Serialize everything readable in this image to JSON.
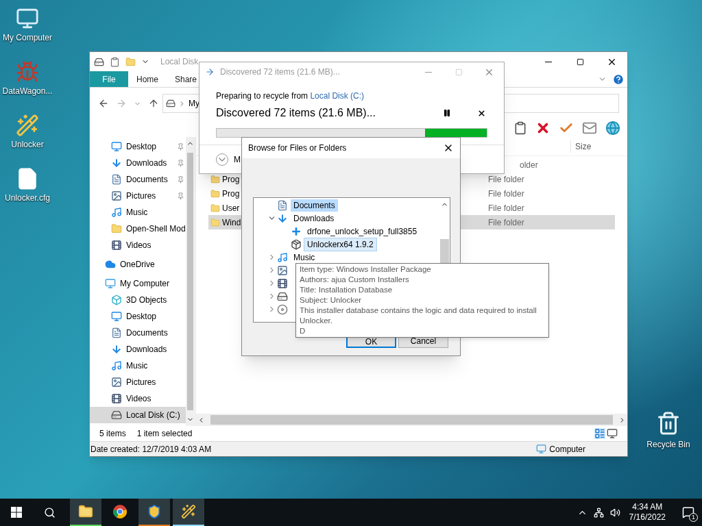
{
  "desktop_icons": [
    {
      "kind": "computer",
      "label": "My Computer"
    },
    {
      "kind": "app",
      "label": "DataWagon..."
    },
    {
      "kind": "unlocker",
      "label": "Unlocker"
    },
    {
      "kind": "file",
      "label": "Unlocker.cfg"
    }
  ],
  "recycle_bin": {
    "label": "Recycle Bin"
  },
  "explorer": {
    "title": "Local Disk",
    "ribbon_tabs": [
      {
        "label": "File",
        "selected": true
      },
      {
        "label": "Home",
        "selected": false
      },
      {
        "label": "Share",
        "selected": false
      }
    ],
    "breadcrumb": "My",
    "nav": [
      {
        "kind": "desktop",
        "label": "Desktop",
        "pinned": true,
        "selected": false
      },
      {
        "kind": "downloads",
        "label": "Downloads",
        "pinned": true,
        "selected": false
      },
      {
        "kind": "documents",
        "label": "Documents",
        "pinned": true,
        "selected": false
      },
      {
        "kind": "pictures",
        "label": "Pictures",
        "pinned": true,
        "selected": false
      },
      {
        "kind": "music",
        "label": "Music",
        "pinned": false,
        "selected": false
      },
      {
        "kind": "folder",
        "label": "Open-Shell Mod",
        "pinned": false,
        "selected": false
      },
      {
        "kind": "videos",
        "label": "Videos",
        "pinned": false,
        "selected": false
      },
      {
        "kind": "onedrive",
        "label": "OneDrive",
        "pinned": false,
        "selected": false,
        "top": true
      },
      {
        "kind": "computer",
        "label": "My Computer",
        "pinned": false,
        "selected": false,
        "top": true
      },
      {
        "kind": "objects3d",
        "label": "3D Objects",
        "pinned": false,
        "selected": false
      },
      {
        "kind": "desktop",
        "label": "Desktop",
        "pinned": false,
        "selected": false
      },
      {
        "kind": "documents",
        "label": "Documents",
        "pinned": false,
        "selected": false
      },
      {
        "kind": "downloads",
        "label": "Downloads",
        "pinned": false,
        "selected": false
      },
      {
        "kind": "music",
        "label": "Music",
        "pinned": false,
        "selected": false
      },
      {
        "kind": "pictures",
        "label": "Pictures",
        "pinned": false,
        "selected": false
      },
      {
        "kind": "videos",
        "label": "Videos",
        "pinned": false,
        "selected": false
      },
      {
        "kind": "disk",
        "label": "Local Disk (C:)",
        "pinned": false,
        "selected": true
      }
    ],
    "size_header": "Size",
    "rows": [
      {
        "type": "older",
        "selected": false
      },
      {
        "name": "Prog",
        "type": "File folder",
        "selected": false
      },
      {
        "name": "Prog",
        "type": "File folder",
        "selected": false
      },
      {
        "name": "User",
        "type": "File folder",
        "selected": false
      },
      {
        "name": "Wind",
        "type": "File folder",
        "selected": true
      }
    ],
    "item_count": "5 items",
    "selection": "1 item selected",
    "details": "Date created: 12/7/2019 4:03 AM",
    "location": "Computer"
  },
  "progress_dialog": {
    "title": "Discovered 72 items (21.6 MB)...",
    "source_prefix": "Preparing to recycle from ",
    "source_link": "Local Disk (C:)",
    "heading": "Discovered 72 items (21.6 MB)...",
    "bar": {
      "kind": "marquee"
    },
    "more": "M"
  },
  "browse_dialog": {
    "title": "Browse for Files or Folders",
    "tree": [
      {
        "kind": "documents",
        "label": "Documents",
        "selected": true,
        "hover": false
      },
      {
        "kind": "downloads",
        "label": "Downloads",
        "expanded": true,
        "selected": false,
        "hover": false,
        "children": [
          {
            "kind": "setup",
            "label": "drfone_unlock_setup_full3855",
            "selected": false,
            "hover": false
          },
          {
            "kind": "installer",
            "label": "Unlockerx64 1.9.2",
            "selected": false,
            "hover": true
          }
        ]
      },
      {
        "kind": "music",
        "label": "Music",
        "expanded": false,
        "selected": false,
        "hover": false
      },
      {
        "kind": "pictures",
        "expanded": false,
        "selected": false,
        "hover": false
      },
      {
        "kind": "videos",
        "expanded": false,
        "selected": false,
        "hover": false
      },
      {
        "kind": "disk",
        "expanded": false,
        "selected": false,
        "hover": false
      },
      {
        "kind": "dvd",
        "expanded": false,
        "selected": false,
        "hover": false
      }
    ],
    "buttons": [
      {
        "label": "OK",
        "default": true
      },
      {
        "label": "Cancel",
        "default": false
      }
    ]
  },
  "tooltip": [
    "Item type: Windows Installer Package",
    "Authors: ajua Custom Installers",
    "Title: Installation Database",
    "Subject: Unlocker",
    "This installer database contains the logic and data required to install Unlocker.",
    "D"
  ],
  "taskbar": {
    "apps": [
      {
        "kind": "explorer",
        "active": true
      },
      {
        "kind": "chrome",
        "active": false
      },
      {
        "kind": "shield",
        "active": true
      },
      {
        "kind": "wand",
        "active": true
      }
    ],
    "time": "4:34 AM",
    "date": "7/16/2022",
    "notifications": "1"
  }
}
